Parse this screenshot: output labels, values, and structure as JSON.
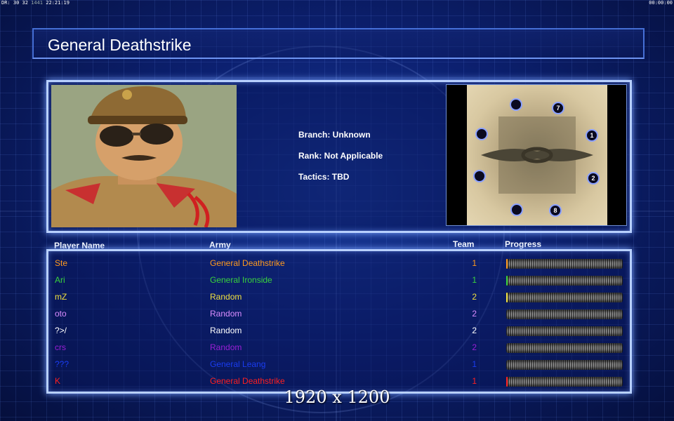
{
  "topbar": {
    "left_prefix": "DR: 30 32",
    "left_dim": "1441",
    "clock": "22:21:19",
    "right_timer": "00:00:00"
  },
  "title": "General Deathstrike",
  "info": {
    "branch": "Branch: Unknown",
    "rank": "Rank: Not Applicable",
    "tactics": "Tactics: TBD"
  },
  "map": {
    "start_markers": [
      "7",
      "1",
      "2",
      "8"
    ]
  },
  "table": {
    "headers": {
      "player": "Player Name",
      "army": "Army",
      "team": "Team",
      "progress": "Progress"
    },
    "rows": [
      {
        "name": "Ste",
        "army": "General Deathstrike",
        "team": "1",
        "color": "#ff9a1e",
        "progress": 0.01
      },
      {
        "name": "Ari",
        "army": "General Ironside",
        "team": "1",
        "color": "#39d23c",
        "progress": 0.01
      },
      {
        "name": "mZ",
        "army": "Random",
        "team": "2",
        "color": "#f0e040",
        "progress": 0.01
      },
      {
        "name": "oto",
        "army": "Random",
        "team": "2",
        "color": "#d98cff",
        "progress": 0.0
      },
      {
        "name": "?>/",
        "army": "Random",
        "team": "2",
        "color": "#ffffff",
        "progress": 0.0
      },
      {
        "name": "crs",
        "army": "Random",
        "team": "2",
        "color": "#9a1fd6",
        "progress": 0.0
      },
      {
        "name": "???",
        "army": "General Leang",
        "team": "1",
        "color": "#1a3cf0",
        "progress": 0.0
      },
      {
        "name": "K",
        "army": "General Deathstrike",
        "team": "1",
        "color": "#ff2020",
        "progress": 0.01
      }
    ]
  },
  "watermark": "1920 x 1200"
}
